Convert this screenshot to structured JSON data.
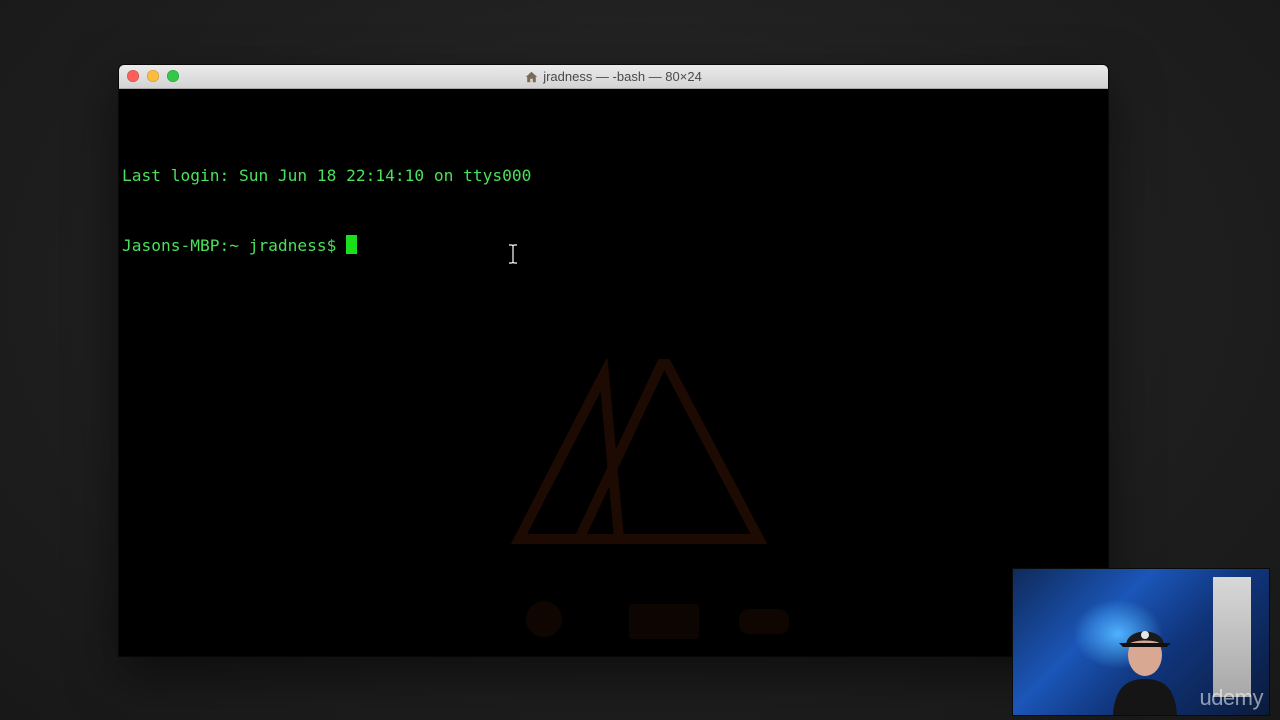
{
  "window": {
    "title": "jradness — -bash — 80×24",
    "home_icon": "home-icon"
  },
  "terminal": {
    "lines": [
      "Last login: Sun Jun 18 22:14:10 on ttys000",
      "Jasons-MBP:~ jradness$ "
    ],
    "text_color": "#4ae05a",
    "cursor_color": "#19e01a",
    "background": "#000000"
  },
  "webcam": {
    "watermark": "udemy"
  },
  "colors": {
    "close": "#fc605c",
    "minimize": "#fdbc40",
    "maximize": "#34c84a"
  }
}
